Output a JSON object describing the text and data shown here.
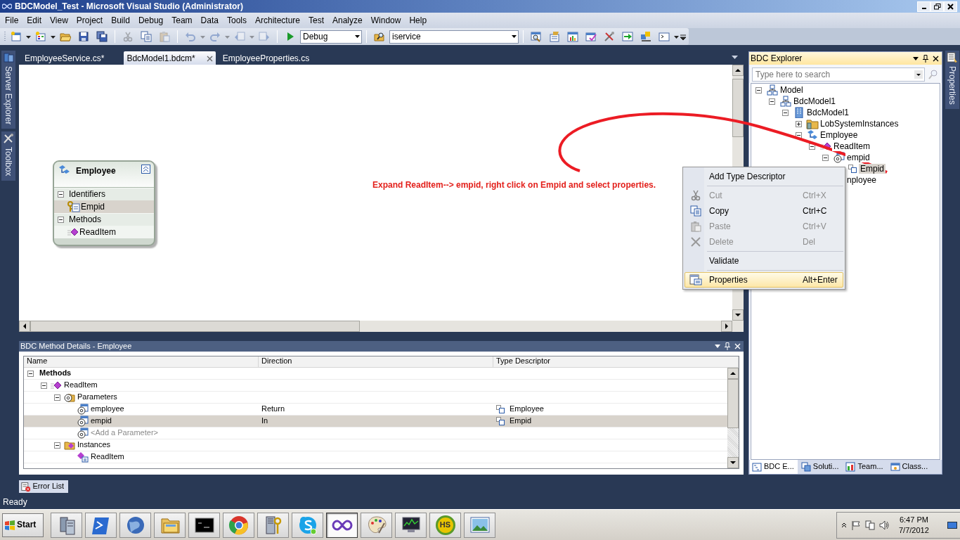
{
  "window": {
    "title": "BDCModel_Test - Microsoft Visual Studio (Administrator)"
  },
  "menu": [
    "File",
    "Edit",
    "View",
    "Project",
    "Build",
    "Debug",
    "Team",
    "Data",
    "Tools",
    "Architecture",
    "Test",
    "Analyze",
    "Window",
    "Help"
  ],
  "toolbar": [
    {
      "kind": "button",
      "disabled": false,
      "dropdown": true
    },
    {
      "kind": "button",
      "disabled": false,
      "dropdown": true
    },
    {
      "kind": "button",
      "disabled": false,
      "dropdown": false
    },
    {
      "kind": "button",
      "disabled": false,
      "dropdown": false
    },
    {
      "kind": "button",
      "disabled": false,
      "dropdown": false
    },
    {
      "kind": "separator"
    },
    {
      "kind": "button",
      "disabled": true,
      "dropdown": false
    },
    {
      "kind": "button",
      "disabled": false,
      "dropdown": false
    },
    {
      "kind": "button",
      "disabled": true,
      "dropdown": false
    },
    {
      "kind": "separator"
    },
    {
      "kind": "button",
      "disabled": true,
      "dropdown": true
    },
    {
      "kind": "button",
      "disabled": true,
      "dropdown": true
    },
    {
      "kind": "button",
      "disabled": true,
      "dropdown": true
    },
    {
      "kind": "button",
      "disabled": true,
      "dropdown": false
    },
    {
      "kind": "separator"
    },
    {
      "kind": "button",
      "disabled": false,
      "dropdown": false
    },
    {
      "kind": "combo",
      "value": "Debug"
    },
    {
      "kind": "separator"
    },
    {
      "kind": "button",
      "disabled": false,
      "dropdown": false
    },
    {
      "kind": "combo",
      "value": "iservice"
    },
    {
      "kind": "separator"
    },
    {
      "kind": "button",
      "disabled": false,
      "dropdown": false
    },
    {
      "kind": "button",
      "disabled": false,
      "dropdown": false
    },
    {
      "kind": "button",
      "disabled": false,
      "dropdown": false
    },
    {
      "kind": "button",
      "disabled": false,
      "dropdown": false
    },
    {
      "kind": "button",
      "disabled": false,
      "dropdown": false
    },
    {
      "kind": "button",
      "disabled": false,
      "dropdown": false
    },
    {
      "kind": "button",
      "disabled": false,
      "dropdown": false
    },
    {
      "kind": "button",
      "disabled": false,
      "dropdown": true
    }
  ],
  "side_tabs_left": [
    {
      "label": "Server Explorer"
    },
    {
      "label": "Toolbox"
    }
  ],
  "side_tabs_right": [
    {
      "label": "Properties"
    }
  ],
  "document_tabs": [
    {
      "label": "EmployeeService.cs*",
      "selected": false
    },
    {
      "label": "BdcModel1.bdcm*",
      "selected": true
    },
    {
      "label": "EmployeeProperties.cs",
      "selected": false
    }
  ],
  "entity": {
    "title": "Employee",
    "sections": [
      {
        "label": "Identifiers",
        "expanded": true,
        "items": [
          {
            "label": "Empid",
            "kind": "identifier",
            "selected": true
          }
        ]
      },
      {
        "label": "Methods",
        "expanded": true,
        "items": [
          {
            "label": "ReadItem",
            "kind": "method",
            "selected": false
          }
        ]
      }
    ]
  },
  "annotation": "Expand ReadItem--> empid, right click on Empid and select properties.",
  "context_menu": [
    {
      "kind": "item",
      "label": "Add Type Descriptor",
      "disabled": false,
      "selected": false
    },
    {
      "kind": "separator"
    },
    {
      "kind": "item",
      "label": "Cut",
      "shortcut": "Ctrl+X",
      "disabled": true,
      "selected": false
    },
    {
      "kind": "item",
      "label": "Copy",
      "shortcut": "Ctrl+C",
      "disabled": false,
      "selected": false
    },
    {
      "kind": "item",
      "label": "Paste",
      "shortcut": "Ctrl+V",
      "disabled": true,
      "selected": false
    },
    {
      "kind": "item",
      "label": "Delete",
      "shortcut": "Del",
      "disabled": true,
      "selected": false
    },
    {
      "kind": "separator"
    },
    {
      "kind": "item",
      "label": "Validate",
      "disabled": false,
      "selected": false
    },
    {
      "kind": "separator"
    },
    {
      "kind": "item",
      "label": "Properties",
      "shortcut": "Alt+Enter",
      "disabled": false,
      "selected": true
    }
  ],
  "bdc_explorer": {
    "title": "BDC Explorer",
    "search": {
      "placeholder": "Type here to search"
    },
    "tree": [
      {
        "label": "Model",
        "kind": "model",
        "expanded": true,
        "selected": false,
        "children": [
          {
            "label": "BdcModel1",
            "kind": "model",
            "expanded": true,
            "selected": false,
            "children": [
              {
                "label": "BdcModel1",
                "kind": "system",
                "expanded": true,
                "selected": false,
                "children": [
                  {
                    "label": "LobSystemInstances",
                    "kind": "folder",
                    "expanded": false,
                    "selected": false
                  },
                  {
                    "label": "Employee",
                    "kind": "entity",
                    "expanded": true,
                    "selected": false,
                    "children": [
                      {
                        "label": "ReadItem",
                        "kind": "method",
                        "expanded": true,
                        "selected": false,
                        "children": [
                          {
                            "label": "empid",
                            "kind": "parameter",
                            "expanded": true,
                            "selected": false,
                            "children": [
                              {
                                "label": "Empid",
                                "kind": "type",
                                "selected": true
                              }
                            ]
                          },
                          {
                            "label": "nployee",
                            "selected": false
                          }
                        ]
                      }
                    ]
                  }
                ]
              }
            ]
          }
        ]
      }
    ],
    "tabs": [
      {
        "label": "BDC E...",
        "selected": true
      },
      {
        "label": "Soluti...",
        "selected": false
      },
      {
        "label": "Team...",
        "selected": false
      },
      {
        "label": "Class...",
        "selected": false
      }
    ]
  },
  "method_details": {
    "title": "BDC Method Details - Employee",
    "columns": [
      "Name",
      "Direction",
      "Type Descriptor"
    ],
    "rows": [
      {
        "name": "Methods",
        "kind": "group",
        "expanded": true,
        "selected": false,
        "children": [
          {
            "name": "ReadItem",
            "kind": "method",
            "expanded": true,
            "selected": false,
            "children": [
              {
                "name": "Parameters",
                "kind": "parameters",
                "expanded": true,
                "selected": false,
                "children": [
                  {
                    "name": "employee",
                    "kind": "parameter",
                    "direction": "Return",
                    "type_descriptor": "Employee",
                    "selected": false
                  },
                  {
                    "name": "empid",
                    "kind": "parameter",
                    "direction": "In",
                    "type_descriptor": "Empid",
                    "selected": true
                  },
                  {
                    "name": "<Add a Parameter>",
                    "kind": "add",
                    "selected": false
                  }
                ]
              },
              {
                "name": "Instances",
                "kind": "instances",
                "expanded": true,
                "selected": false,
                "children": [
                  {
                    "name": "ReadItem",
                    "kind": "instance",
                    "selected": false
                  }
                ]
              }
            ]
          }
        ]
      }
    ]
  },
  "bottom_tabs": [
    {
      "label": "Error List"
    }
  ],
  "status_bar": "Ready",
  "taskbar": {
    "start": "Start",
    "apps": [
      {
        "kind": "server",
        "selected": false
      },
      {
        "kind": "prompt",
        "selected": false
      },
      {
        "kind": "globe",
        "selected": false
      },
      {
        "kind": "folder",
        "selected": false
      },
      {
        "kind": "console",
        "selected": false
      },
      {
        "kind": "browser",
        "selected": false
      },
      {
        "kind": "tools",
        "selected": false
      },
      {
        "kind": "chat",
        "selected": false
      },
      {
        "kind": "infinity",
        "selected": true
      },
      {
        "kind": "palette",
        "selected": false
      },
      {
        "kind": "monitor",
        "selected": false
      },
      {
        "kind": "badge",
        "label": "HS",
        "selected": false
      },
      {
        "kind": "picture",
        "selected": false
      }
    ],
    "time": "6:47 PM",
    "date": "7/7/2012"
  }
}
